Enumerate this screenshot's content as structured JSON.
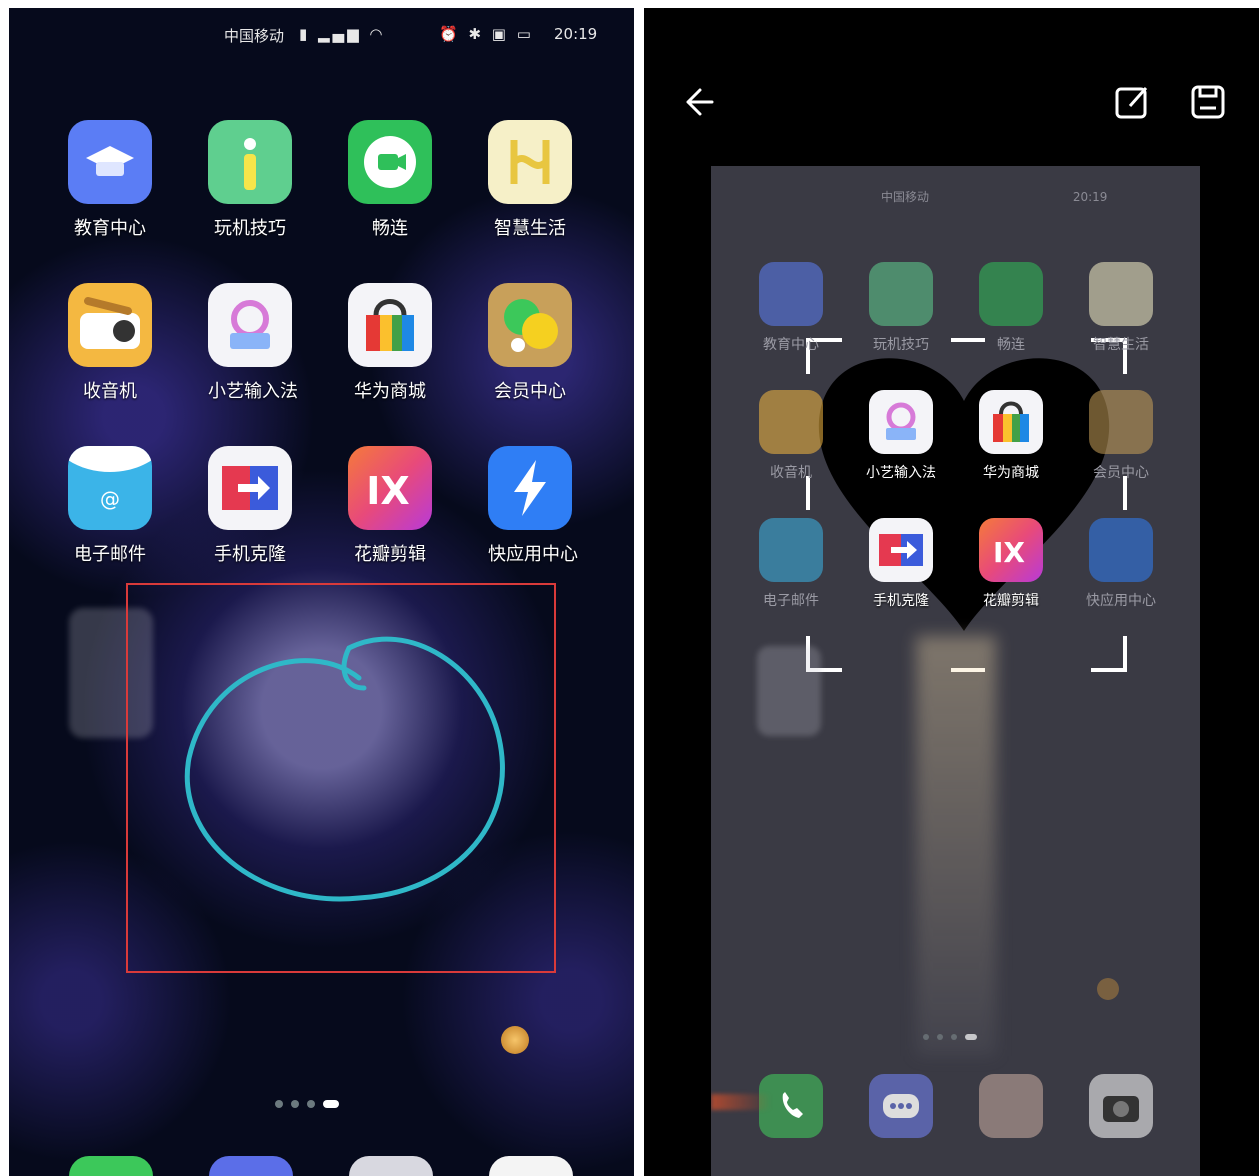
{
  "left_screen": {
    "status_left": "中国移动",
    "status_right": "20:19",
    "apps": [
      {
        "label": "教育中心",
        "color": "#5b7df5"
      },
      {
        "label": "玩机技巧",
        "color": "#5fcf8f"
      },
      {
        "label": "畅连",
        "color": "#2fc05a"
      },
      {
        "label": "智慧生活",
        "color": "#f6f0c8"
      },
      {
        "label": "收音机",
        "color": "#f4b841"
      },
      {
        "label": "小艺输入法",
        "color": "#f4f4f8"
      },
      {
        "label": "华为商城",
        "color": "#f4f4f8"
      },
      {
        "label": "会员中心",
        "color": "#c8a05a"
      },
      {
        "label": "电子邮件",
        "color": "#3bb4e8"
      },
      {
        "label": "手机克隆",
        "color": "#f4f4f8"
      },
      {
        "label": "花瓣剪辑",
        "color": "#e84a7a"
      },
      {
        "label": "快应用中心",
        "color": "#2f7ef5"
      }
    ]
  },
  "right_screen": {
    "back_icon": "arrow-left-icon",
    "edit_icon": "edit-icon",
    "save_icon": "save-icon",
    "status_left": "中国移动",
    "status_right": "20:19",
    "apps": [
      {
        "label": "教育中心"
      },
      {
        "label": "玩机技巧"
      },
      {
        "label": "畅连"
      },
      {
        "label": "智慧生活"
      },
      {
        "label": "收音机"
      },
      {
        "label": "小艺输入法"
      },
      {
        "label": "华为商城"
      },
      {
        "label": "会员中心"
      },
      {
        "label": "电子邮件"
      },
      {
        "label": "手机克隆"
      },
      {
        "label": "花瓣剪辑"
      },
      {
        "label": "快应用中心"
      }
    ],
    "dock": [
      "phone-icon",
      "messages-icon",
      "gallery-icon",
      "camera-icon"
    ]
  }
}
